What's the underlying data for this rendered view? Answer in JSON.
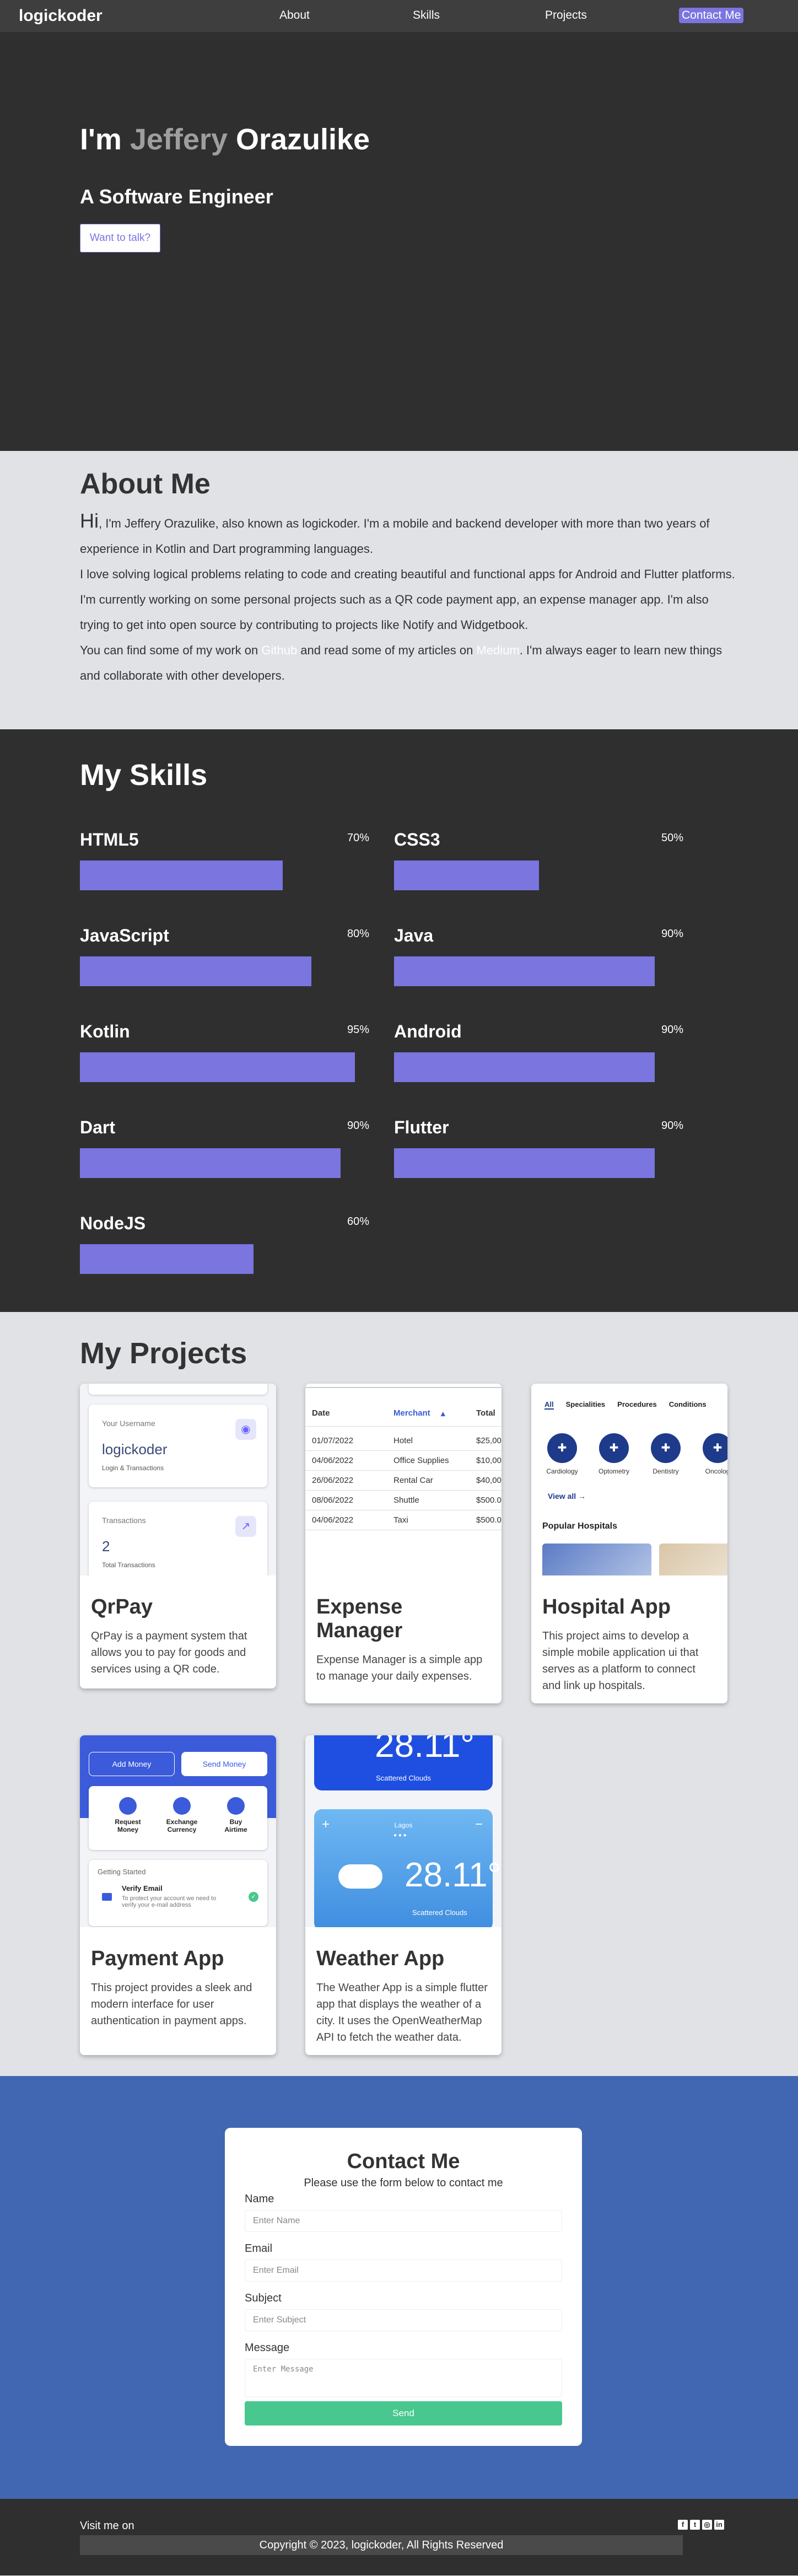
{
  "nav": {
    "logo": "logickoder",
    "links": [
      "About",
      "Skills",
      "Projects"
    ],
    "contact": "Contact Me"
  },
  "hero": {
    "prefix": "I'm ",
    "first": "Jeffery",
    "last": " Orazulike",
    "subtitle": "A Software Engineer",
    "cta": "Want to talk?"
  },
  "about": {
    "title": "About Me",
    "hi": "Hi",
    "p1": ", I'm Jeffery Orazulike, also known as logickoder. I'm a mobile and backend developer with more than two years of experience in Kotlin and Dart programming languages.",
    "p2": "I love solving logical problems relating to code and creating beautiful and functional apps for Android and Flutter platforms.",
    "p3": "I'm currently working on some personal projects such as a QR code payment app, an expense manager app. I'm also trying to get into open source by contributing to projects like Notify and Widgetbook.",
    "p4a": "You can find some of my work on ",
    "github": "Github",
    "p4b": " and read some of my articles on ",
    "medium": "Medium",
    "p4c": ". I'm always eager to learn new things and collaborate with other developers."
  },
  "skills": {
    "title": "My Skills",
    "items": [
      {
        "name": "HTML5",
        "pct": "70%",
        "level": 0.7
      },
      {
        "name": "CSS3",
        "pct": "50%",
        "level": 0.5
      },
      {
        "name": "JavaScript",
        "pct": "80%",
        "level": 0.8
      },
      {
        "name": "Java",
        "pct": "90%",
        "level": 0.9
      },
      {
        "name": "Kotlin",
        "pct": "95%",
        "level": 0.95
      },
      {
        "name": "Android",
        "pct": "90%",
        "level": 0.9
      },
      {
        "name": "Dart",
        "pct": "90%",
        "level": 0.9
      },
      {
        "name": "Flutter",
        "pct": "90%",
        "level": 0.9
      },
      {
        "name": "NodeJS",
        "pct": "60%",
        "level": 0.6
      }
    ]
  },
  "projects": {
    "title": "My Projects",
    "items": [
      {
        "title": "QrPay",
        "desc": "QrPay is a payment system that allows you to pay for goods and services using a QR code."
      },
      {
        "title": "Expense Manager",
        "desc": "Expense Manager is a simple app to manage your daily expenses."
      },
      {
        "title": "Hospital App",
        "desc": "This project aims to develop a simple mobile application ui that serves as a platform to connect and link up hospitals."
      },
      {
        "title": "Payment App",
        "desc": "This project provides a sleek and modern interface for user authentication in payment apps."
      },
      {
        "title": "Weather App",
        "desc": "The Weather App is a simple flutter app that displays the weather of a city. It uses the OpenWeatherMap API to fetch the weather data."
      }
    ],
    "qrpay_shot": {
      "username_label": "Your Username",
      "username": "logickoder",
      "login_tx": "Login & Transactions",
      "tx_label": "Transactions",
      "tx_count": "2",
      "tx_total": "Total Transactions"
    },
    "expense_shot": {
      "headers": [
        "Date",
        "Merchant",
        "Total"
      ],
      "rows": [
        [
          "01/07/2022",
          "Hotel",
          "$25,00"
        ],
        [
          "04/06/2022",
          "Office Supplies",
          "$10,00"
        ],
        [
          "26/06/2022",
          "Rental Car",
          "$40,00"
        ],
        [
          "08/06/2022",
          "Shuttle",
          "$500.0"
        ],
        [
          "04/06/2022",
          "Taxi",
          "$500.0"
        ]
      ]
    },
    "hospital_shot": {
      "tabs": [
        "All",
        "Specialities",
        "Procedures",
        "Conditions"
      ],
      "cats": [
        "Cardiology",
        "Optometry",
        "Dentistry",
        "Oncolog"
      ],
      "view_all": "View all",
      "popular": "Popular Hospitals"
    },
    "payment_shot": {
      "add": "Add Money",
      "send": "Send Money",
      "actions": [
        "Request Money",
        "Exchange Currency",
        "Buy Airtime"
      ],
      "getting_started": "Getting Started",
      "verify": "Verify Email",
      "verify_desc": "To protect your account we need to verify your e-mail address"
    },
    "weather_shot": {
      "temp_top": "28.11°",
      "cond_top": "Scattered Clouds",
      "city": "Lagos",
      "temp": "28.11°",
      "cond": "Scattered Clouds"
    }
  },
  "contact": {
    "title": "Contact Me",
    "subtitle": "Please use the form below to contact me",
    "name_label": "Name",
    "name_ph": "Enter Name",
    "email_label": "Email",
    "email_ph": "Enter Email",
    "subject_label": "Subject",
    "subject_ph": "Enter Subject",
    "message_label": "Message",
    "message_ph": "Enter Message",
    "send": "Send"
  },
  "footer": {
    "visit": "Visit me on",
    "copyright": "Copyright © 2023, logickoder, All Rights Reserved",
    "socials": [
      "facebook-icon",
      "twitter-icon",
      "instagram-icon",
      "linkedin-icon"
    ]
  },
  "colors": {
    "accent": "#7b75e0",
    "dark": "#2f2f2f",
    "contact_bg": "#4267b2",
    "send": "#48c78e"
  }
}
